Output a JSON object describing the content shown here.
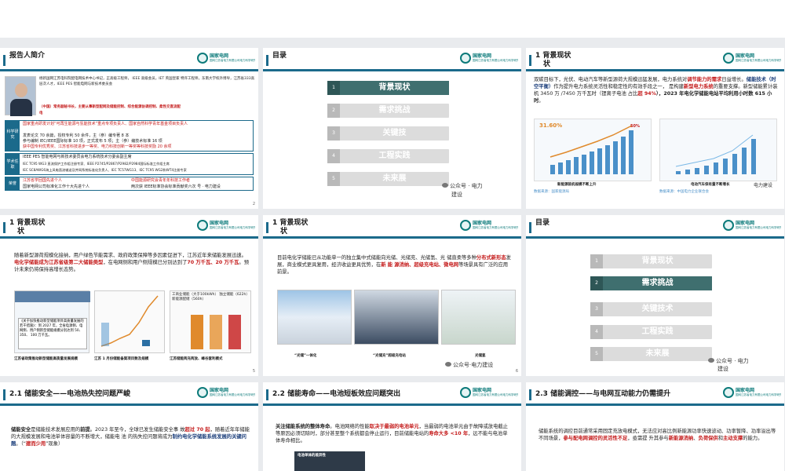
{
  "slides": [
    {
      "title": "报告人简介",
      "num": "2",
      "intro": "杨新国网江苏电科院配电网技术中心书记，正高级工程师， IEEE  高级会员，IET 英国皇家 特许工程师，东南大学校外博导，江苏省333高层次人才，IEEE  PES  智能电网与新技术委员会",
      "intro2": "（中国）常务副秘书长，主要从事新型配网及储能控制、综合能源协调控制、柔性交直流配",
      "intro3": "电",
      "groups": [
        {
          "label": "科学研究",
          "items": [
            "国家重点研发计划“可再生能源与氢能技术”重点专项负责人、国家自然科学青年基金项目负责人",
            "发表论文 70 余篇，授权专利 50 余件，主（参）编专著 8 本",
            "参与编制 IEC/IEEE国际标准 10 项，正式发布 5 项；主（参）编技术标准 16 项",
            "获中国专利优秀奖、江苏省科技进步一等奖、电力科技创新一等奖等科技奖励 20 余项"
          ]
        },
        {
          "label": "学术任职",
          "items": [
            "IEEE PES 智能电网与新技术委员会电力系统技术分委会副主席",
            "IEC TC95 WG3 直流保护工作组注册专家、IEEE P2745/P2867/P2982/P2984国际标准工作组主席",
            "IEC SC8AWG6海上风电直流输送及并网系统标准化负责人、IEC TC57WG13、IEC TC95 WG2和WT4注册专家"
          ]
        },
        {
          "label": "荣誉",
          "items": [
            "江苏省学回国先进个人",
            "国家电网公司标准化工作十大先进个人"
          ]
        }
      ],
      "honor_r1": "中国能源研究会青年年科技工作者",
      "honor_r2": "两次获 IEEE标准协会标准贡献奖六次 号  · 电力建设"
    },
    {
      "title": "目录",
      "items": [
        {
          "n": "1",
          "t": "背景现状"
        },
        {
          "n": "2",
          "t": "需求挑战"
        },
        {
          "n": "3",
          "t": "关键技"
        },
        {
          "n": "4",
          "t": "工程实践"
        },
        {
          "n": "5",
          "t": "未来展"
        }
      ],
      "wechat": "公众号 · 电力",
      "wechat2": "建设"
    },
    {
      "title": "1 背景现状",
      "title2": "状",
      "text1": "双碳目标下，光伏、电动汽车等新型源荷大规模迅猛发展，电力系统对",
      "t_red1": "调节能力的需求",
      "text2": "日益增长。",
      "t_navy": "储能技术（时空平衡）",
      "text3": "作为提升电力系统灵活性和稳定性的有效手段之一， 是构建",
      "t_red2": "新型电力系统",
      "text4": "的重要支撑。新型储能累计装机 3450 万 /7450 万千瓦时（锂离子电池 占比",
      "t_red3": "超 94%",
      "text5": "），2023 年电化学储能电站平均利用小时数 615 小时",
      "text6": "。",
      "chart1": {
        "percent_a": "31.60%",
        "percent_b": "50%",
        "caption": "新能源装机规模不断上升",
        "src": "数据来源：国家能源局"
      },
      "chart2": {
        "caption": "电动汽车保有量不断增长",
        "src": "数据来源：中国电力企业联合会",
        "caption2": "电力建设"
      }
    },
    {
      "title": "1 背景现状",
      "title2": "状",
      "num": "5",
      "text": "随着新型源荷规模化接纳，用户绿色节能需求、政府政策保障等多因素促进下，江苏近年来储能发展迅速。",
      "t_red1": "电化学储能成为江苏省级第二大储能类型",
      "text2": "，在电网侧和用户侧规模已分别达到了",
      "t_red2": "70 万千瓦、20 万千瓦",
      "text3": "。预计未来仍将保持高增长态势。",
      "legend": "工商业储能（大于100kWh） 独立储能（622h）新能源配储（560h）",
      "box": "《关于加快推动新型储能项目高质量发展的若干措施》：到 2027 年，全省电源侧、电网侧、用户侧新型储能规模分别达到  50、 350、 100 万千瓦。",
      "caps": [
        "江苏省政策推动新型储能高质量发展规模",
        "江苏 1 月份储能备案项目数及规模",
        "江苏储能两充两放、峰谷套利模式"
      ]
    },
    {
      "title": "1 背景现状",
      "title2": "状",
      "num": "6",
      "text": "目前电化学储能已从功能单一的独立集中式储能向光储、光储充、光储氢、光 储直柔等多种",
      "t_red1": "分布式新形态",
      "text2": "发展，商业模式更具复用，经济收益更具优势，在",
      "t_red2": "新 能 源消纳、超级充电站、微电网",
      "text3": "等场景具有广泛的应用前景。",
      "caps": [
        "“光储”一体化",
        "“光储充”超级充电站",
        "光储氢"
      ],
      "wechat": "公众号·电力建设"
    },
    {
      "title": "目录",
      "items": [
        {
          "n": "1",
          "t": "背景现状"
        },
        {
          "n": "2",
          "t": "需求挑战"
        },
        {
          "n": "3",
          "t": "关键技术"
        },
        {
          "n": "4",
          "t": "工程实践"
        },
        {
          "n": "5",
          "t": "未来展"
        }
      ],
      "wechat": "公众号 · 电力",
      "wechat2": "建设"
    },
    {
      "title": "2.1 储能安全——电池热失控问题严峻",
      "t_bold": "储能安全",
      "text": "是储能技术发展应用的",
      "t_bold2": "前提",
      "text2": "。2023 年至今，全球已发生储能安全事 故",
      "t_red1": "超过 70 起",
      "text3": "，随着近年年储能的大规模发展和电池单体容量的不断增大，储能电 池 的热失控问题将成为",
      "t_red2": "制约电化学储能系统发展的关键问题",
      "text4": "。（“",
      "t_red3": "建而少用",
      "text5": "”现象）"
    },
    {
      "title": "2.2 储能寿命——电池短板效应问题突出",
      "t_bold": "关注储能系统的整体寿命",
      "text": "。电池网络的性能",
      "t_red1": "取决于最弱的电池单元",
      "text2": "，当最弱的电池单元由于故障或放电截止等原因必须切除时，部分甚至整个系统都会停止运行，目前储能电站的",
      "t_red2": "寿命大多 <10 年",
      "text3": "，远不能与电池单体寿命相比。",
      "fig_label": "电池单体的差异性"
    },
    {
      "title": "2.3 储能调控——与电网互动能力仍需提升",
      "text": "储能系统的调控目前通常采用固定充放电模式，无法应对高比例新能源功率快速波动、功率暂降、功率溢出等不同场景，",
      "t_red1": "参与配电网调控的灵活性不足",
      "text2": "，亟需提 升其参与",
      "t_red2": "新能源消纳",
      "text3": "、",
      "t_red3": "负荷保供",
      "text4": "和",
      "t_red4": "主动支撑",
      "text5": "的能力。"
    }
  ],
  "colors": {
    "brand": "#1b6a8b",
    "accent_red": "#c41a1a",
    "toc_active": "#3f6f6f"
  },
  "logo": {
    "name": "国家电网",
    "sub": "国网江苏省电力有限公司电力科学研究院"
  }
}
